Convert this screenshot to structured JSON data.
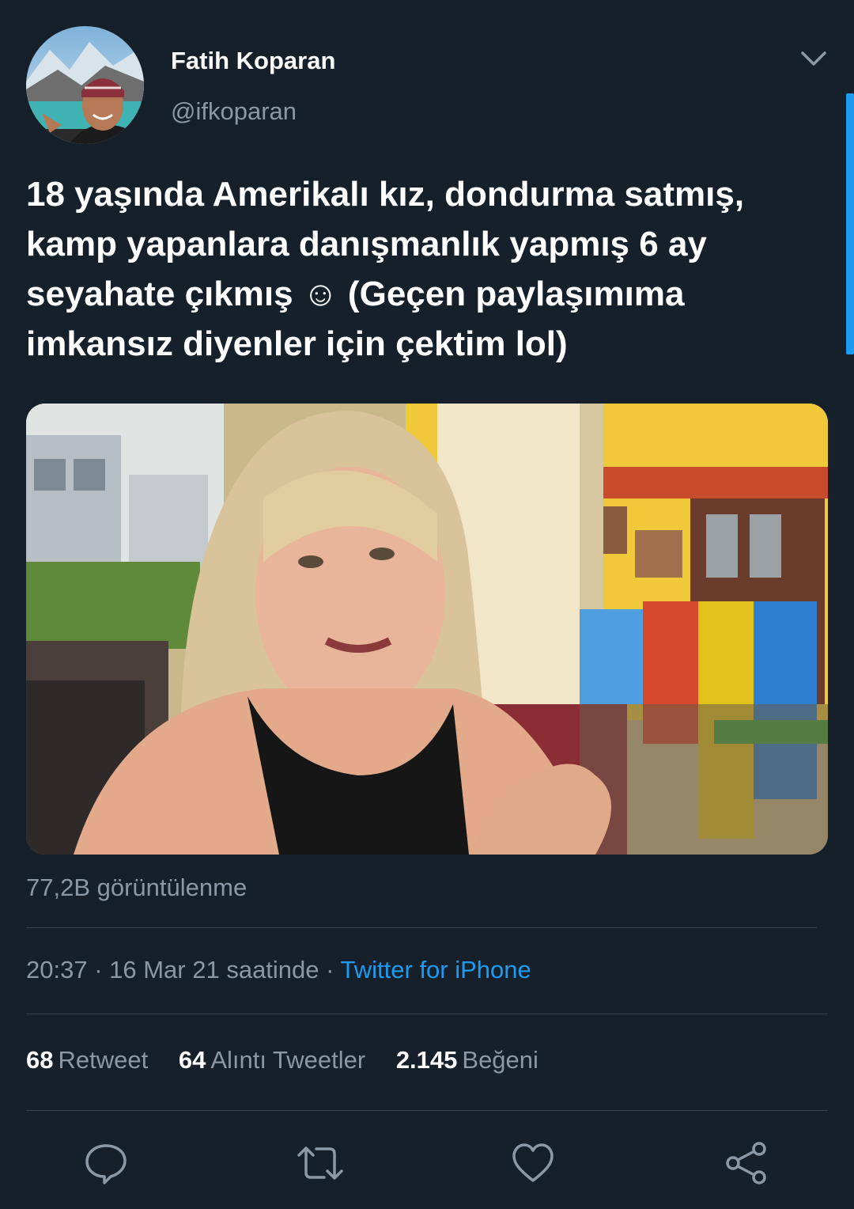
{
  "author": {
    "display_name": "Fatih Koparan",
    "handle": "@ifkoparan"
  },
  "tweet": {
    "text": "18 yaşında Amerikalı kız, dondurma satmış, kamp yapanlara danışmanlık yapmış 6 ay seyahate çıkmış ☺ (Geçen paylaşımıma imkansız diyenler için çektim lol)"
  },
  "media": {
    "views": "77,2B görüntülenme"
  },
  "meta": {
    "time": "20:37",
    "date": "16 Mar 21 saatinde",
    "separator": " · ",
    "source": "Twitter for iPhone"
  },
  "stats": [
    {
      "count": "68",
      "label": "Retweet"
    },
    {
      "count": "64",
      "label": "Alıntı Tweetler"
    },
    {
      "count": "2.145",
      "label": "Beğeni"
    }
  ],
  "icons": {
    "more": "chevron-down-icon",
    "reply": "reply-icon",
    "retweet": "retweet-icon",
    "like": "heart-icon",
    "share": "share-icon"
  },
  "colors": {
    "background": "#15202b",
    "text": "#ffffff",
    "secondary": "#8b98a5",
    "accent": "#1d9bf0",
    "divider": "#38444d"
  }
}
